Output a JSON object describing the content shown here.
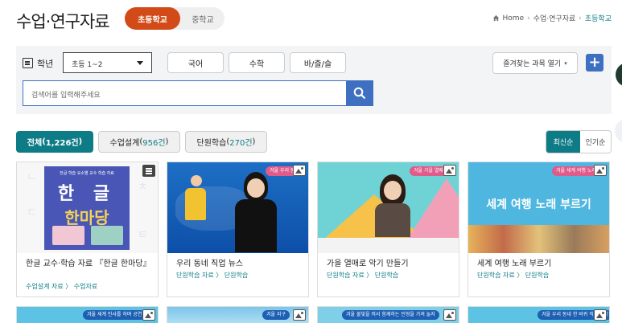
{
  "header": {
    "title": "수업·연구자료",
    "school_tabs": [
      {
        "label": "초등학교",
        "active": true
      },
      {
        "label": "중학교",
        "active": false
      }
    ],
    "breadcrumb": [
      "Home",
      "수업·연구자료",
      "초등학교"
    ]
  },
  "search": {
    "grade_label": "학년",
    "grade_value": "초등 1~2",
    "subjects": [
      "국어",
      "수학",
      "바/즐/슬"
    ],
    "favorites_label": "즐겨찾는 과목 열기",
    "add_label": "+",
    "placeholder": "검색어를 입력해주세요"
  },
  "filters": {
    "tabs": [
      {
        "name": "전체",
        "count": "1,226건",
        "active": true
      },
      {
        "name": "수업설계",
        "count": "956건",
        "active": false
      },
      {
        "name": "단원학습",
        "count": "270건",
        "active": false
      }
    ],
    "sort": [
      {
        "label": "최신순",
        "active": true
      },
      {
        "label": "인기순",
        "active": false
      }
    ]
  },
  "cards": [
    {
      "title": "한글 교수·학습 자료 『한글 한마당』",
      "path": "수업설계 자료 〉 수업자료",
      "badge": "doc-icon",
      "thumb_text": {
        "top": "한글 학습 요소별 교수 학습 자료",
        "line1": "한 글",
        "line2": "한마당"
      }
    },
    {
      "title": "우리 동네 직업 뉴스",
      "path": "단원학습 자료 〉 단원학습",
      "badge": "image-icon",
      "thumb_pill": "겨울 우리 동네"
    },
    {
      "title": "가을 열매로 악기 만들기",
      "path": "단원학습 자료 〉 단원학습",
      "badge": "image-icon",
      "thumb_pill": "겨울 가을 열매로"
    },
    {
      "title": "세계 여행 노래 부르기",
      "path": "단원학습 자료 〉 단원학습",
      "badge": "image-icon",
      "thumb_pill": "겨울 세계 여행 노래",
      "thumb_text": "세계 여행 노래 부르기"
    }
  ],
  "cards_row2": [
    {
      "pill": "겨울 세계 인사를 하며 공연"
    },
    {
      "pill": "겨울 지구"
    },
    {
      "pill": "겨울 불빛을 켜서 함께하는 인형을 가져 놀자"
    },
    {
      "pill": "겨울 우리 동네 한 바퀴 직업 탐방"
    }
  ],
  "colors": {
    "accent_orange": "#d24a17",
    "teal": "#0e7c86",
    "blue": "#3f6fc1"
  }
}
